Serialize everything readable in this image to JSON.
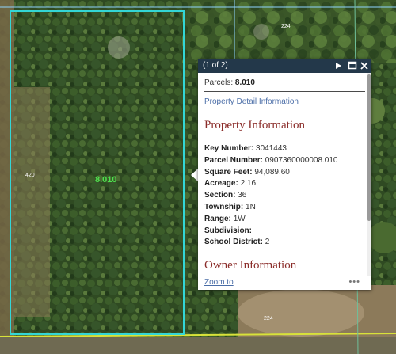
{
  "map": {
    "parcel_label": "8.010",
    "road_labels": [
      "224",
      "420",
      "224"
    ],
    "colors": {
      "parcel_outline": "#33d6d6",
      "road_line": "#d8e23a",
      "parcel_label": "#4ee24e",
      "other_lines": "#8fd4ff"
    }
  },
  "popup": {
    "count": "(1 of 2)",
    "icons": [
      "play-icon",
      "maximize-icon",
      "close-icon"
    ],
    "title_label": "Parcels:",
    "title_value": "8.010",
    "detail_link": "Property Detail Information",
    "property_heading": "Property Information",
    "fields": [
      {
        "label": "Key Number:",
        "value": "3041443"
      },
      {
        "label": "Parcel Number:",
        "value": "0907360000008.010"
      },
      {
        "label": "Square Feet:",
        "value": "94,089.60"
      },
      {
        "label": "Acreage:",
        "value": "2.16"
      },
      {
        "label": "Section:",
        "value": "36"
      },
      {
        "label": "Township:",
        "value": "1N"
      },
      {
        "label": "Range:",
        "value": "1W"
      },
      {
        "label": "Subdivision:",
        "value": ""
      },
      {
        "label": "School District:",
        "value": "2"
      }
    ],
    "owner_heading": "Owner Information",
    "zoom_link": "Zoom to",
    "more_icon": "ellipsis-icon",
    "more_text": "•••"
  }
}
